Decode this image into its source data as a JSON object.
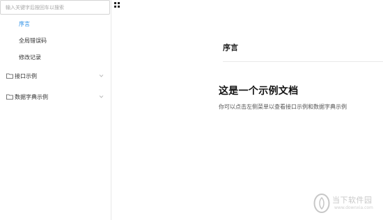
{
  "search": {
    "placeholder": "输入关键字后按回车以搜索",
    "value": ""
  },
  "sidebar": {
    "items": [
      {
        "label": "序言",
        "active": true
      },
      {
        "label": "全局错误码",
        "active": false
      },
      {
        "label": "修改记录",
        "active": false
      }
    ],
    "groups": [
      {
        "label": "接口示例",
        "icon": "folder-icon",
        "expanded": false
      },
      {
        "label": "数据字典示例",
        "icon": "folder-icon",
        "expanded": false
      }
    ]
  },
  "toolbar": {
    "toggle_icon": "grid-icon"
  },
  "main": {
    "title": "序言",
    "heading": "这是一个示例文档",
    "text": "你可以点击左侧菜单以查看接口示例和数据字典示例"
  },
  "watermark": {
    "name": "当下软件园",
    "url": "www.downxia.com"
  },
  "colors": {
    "accent": "#1e88e5",
    "border": "#e8e8e8"
  }
}
